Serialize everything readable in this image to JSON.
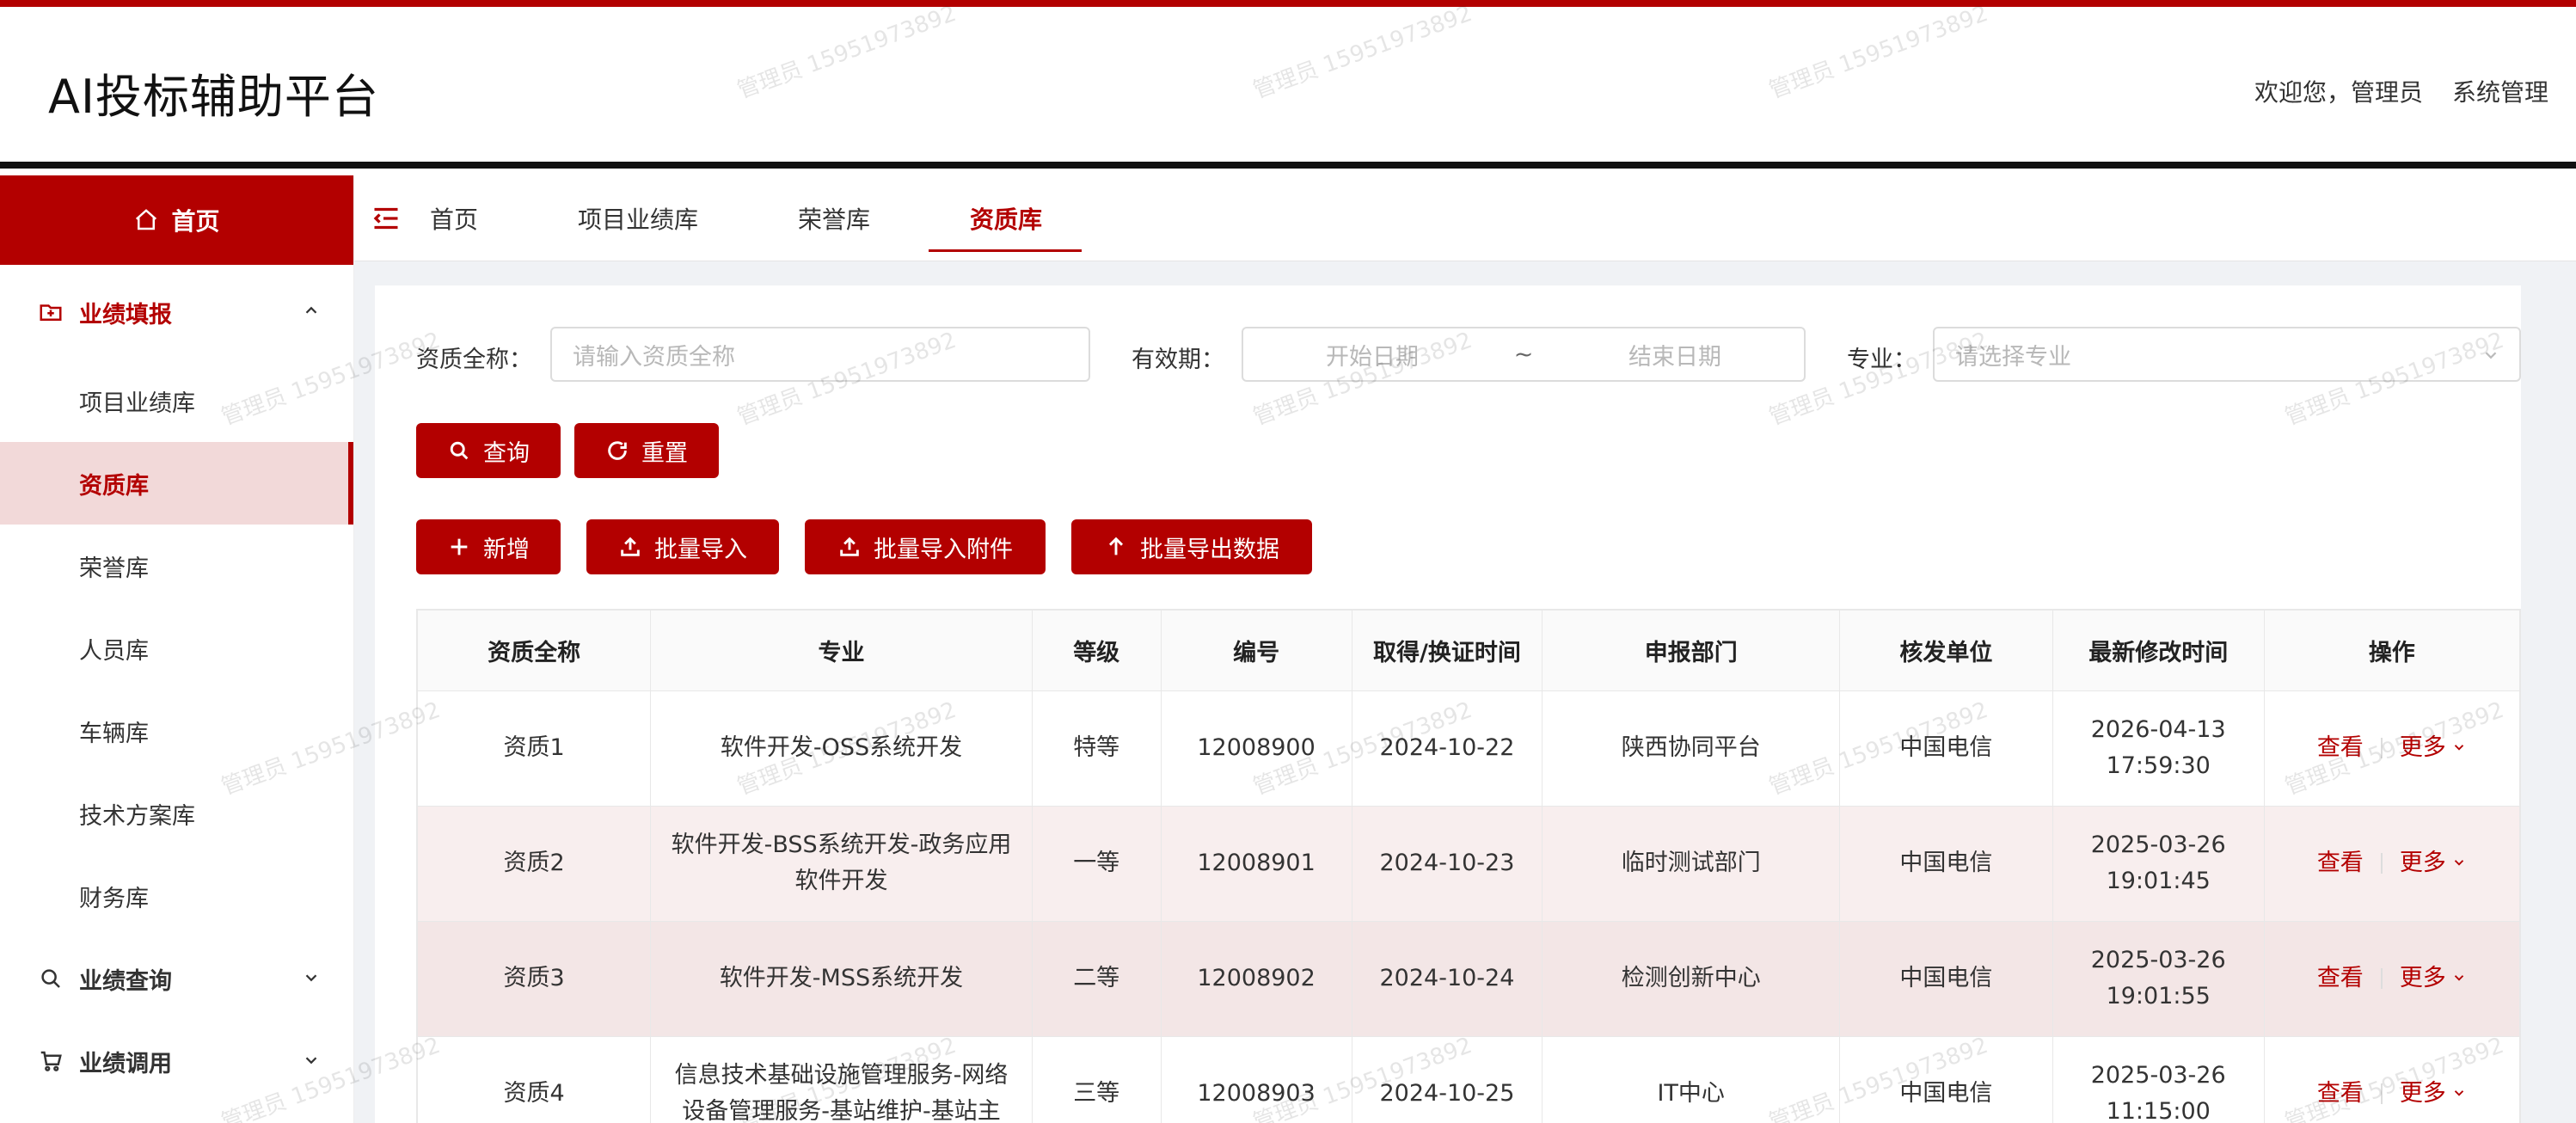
{
  "app": {
    "title": "AI投标辅助平台"
  },
  "header": {
    "welcome": "欢迎您，管理员",
    "system_manage": "系统管理"
  },
  "sidebar": {
    "home": "首页",
    "group1": {
      "label": "业绩填报",
      "items": [
        "项目业绩库",
        "资质库",
        "荣誉库",
        "人员库",
        "车辆库",
        "技术方案库",
        "财务库"
      ],
      "active_index": 1
    },
    "group2": {
      "label": "业绩查询"
    },
    "group3": {
      "label": "业绩调用"
    }
  },
  "tabs": [
    {
      "label": "首页"
    },
    {
      "label": "项目业绩库"
    },
    {
      "label": "荣誉库"
    },
    {
      "label": "资质库"
    }
  ],
  "filters": {
    "name_label": "资质全称：",
    "name_placeholder": "请输入资质全称",
    "validity_label": "有效期：",
    "start_placeholder": "开始日期",
    "range_sep": "~",
    "end_placeholder": "结束日期",
    "major_label": "专业：",
    "major_placeholder": "请选择专业"
  },
  "buttons": {
    "query": "查询",
    "reset": "重置",
    "add": "新增",
    "batch_import": "批量导入",
    "batch_import_attach": "批量导入附件",
    "batch_export": "批量导出数据"
  },
  "table": {
    "headers": [
      "资质全称",
      "专业",
      "等级",
      "编号",
      "取得/换证时间",
      "申报部门",
      "核发单位",
      "最新修改时间",
      "操作"
    ],
    "rows": [
      {
        "name": "资质1",
        "major": "软件开发-OSS系统开发",
        "level": "特等",
        "code": "12008900",
        "date": "2024-10-22",
        "dept": "陕西协同平台",
        "issuer": "中国电信",
        "mod_date": "2026-04-13",
        "mod_time": "17:59:30"
      },
      {
        "name": "资质2",
        "major": "软件开发-BSS系统开发-政务应用软件开发",
        "level": "一等",
        "code": "12008901",
        "date": "2024-10-23",
        "dept": "临时测试部门",
        "issuer": "中国电信",
        "mod_date": "2025-03-26",
        "mod_time": "19:01:45"
      },
      {
        "name": "资质3",
        "major": "软件开发-MSS系统开发",
        "level": "二等",
        "code": "12008902",
        "date": "2024-10-24",
        "dept": "检测创新中心",
        "issuer": "中国电信",
        "mod_date": "2025-03-26",
        "mod_time": "19:01:55"
      },
      {
        "name": "资质4",
        "major": "信息技术基础设施管理服务-网络设备管理服务-基站维护-基站主",
        "level": "三等",
        "code": "12008903",
        "date": "2024-10-25",
        "dept": "IT中心",
        "issuer": "中国电信",
        "mod_date": "2025-03-26",
        "mod_time": "11:15:00"
      }
    ],
    "op_view": "查看",
    "op_more": "更多"
  },
  "watermark_text": "管理员 15951973892",
  "colors": {
    "primary": "#b30000",
    "active_bg": "#f2d9d9"
  }
}
